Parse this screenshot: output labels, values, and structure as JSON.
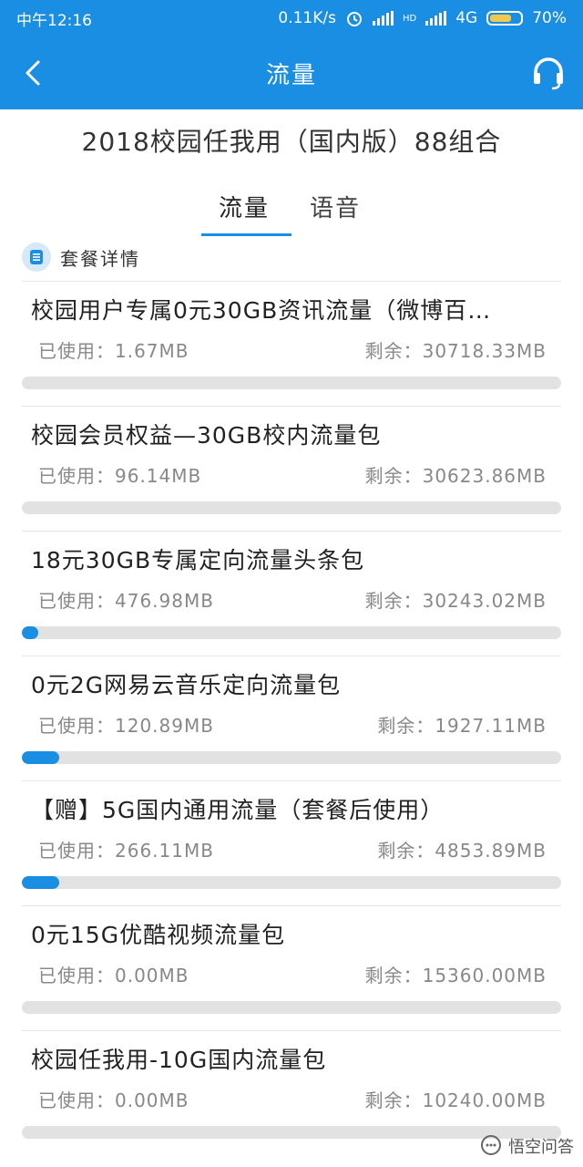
{
  "status_bar": {
    "time": "中午12:16",
    "net_speed": "0.11K/s",
    "hd": "HD",
    "network": "4G",
    "battery": "70%",
    "battery_level": 0.7
  },
  "nav": {
    "title": "流量"
  },
  "plan_title": "2018校园任我用（国内版）88组合",
  "tabs": [
    {
      "label": "流量",
      "active": true
    },
    {
      "label": "语音",
      "active": false
    }
  ],
  "section": {
    "label": "套餐详情"
  },
  "items": [
    {
      "name": "校园用户专属0元30GB资讯流量（微博百…",
      "used_label": "已使用：",
      "used": "1.67MB",
      "remain_label": "剩余：",
      "remain": "30718.33MB",
      "progress": 0.0
    },
    {
      "name": "校园会员权益—30GB校内流量包",
      "used_label": "已使用：",
      "used": "96.14MB",
      "remain_label": "剩余：",
      "remain": "30623.86MB",
      "progress": 0.0
    },
    {
      "name": "18元30GB专属定向流量头条包",
      "used_label": "已使用：",
      "used": "476.98MB",
      "remain_label": "剩余：",
      "remain": "30243.02MB",
      "progress": 0.03
    },
    {
      "name": "0元2G网易云音乐定向流量包",
      "used_label": "已使用：",
      "used": "120.89MB",
      "remain_label": "剩余：",
      "remain": "1927.11MB",
      "progress": 0.07
    },
    {
      "name": "【赠】5G国内通用流量（套餐后使用）",
      "used_label": "已使用：",
      "used": "266.11MB",
      "remain_label": "剩余：",
      "remain": "4853.89MB",
      "progress": 0.07
    },
    {
      "name": "0元15G优酷视频流量包",
      "used_label": "已使用：",
      "used": "0.00MB",
      "remain_label": "剩余：",
      "remain": "15360.00MB",
      "progress": 0.0
    },
    {
      "name": "校园任我用-10G国内流量包",
      "used_label": "已使用：",
      "used": "0.00MB",
      "remain_label": "剩余：",
      "remain": "10240.00MB",
      "progress": 0.0
    }
  ],
  "watermark": {
    "text": "悟空问答"
  },
  "colors": {
    "accent": "#1a8ee3",
    "track": "#e2e2e2"
  }
}
